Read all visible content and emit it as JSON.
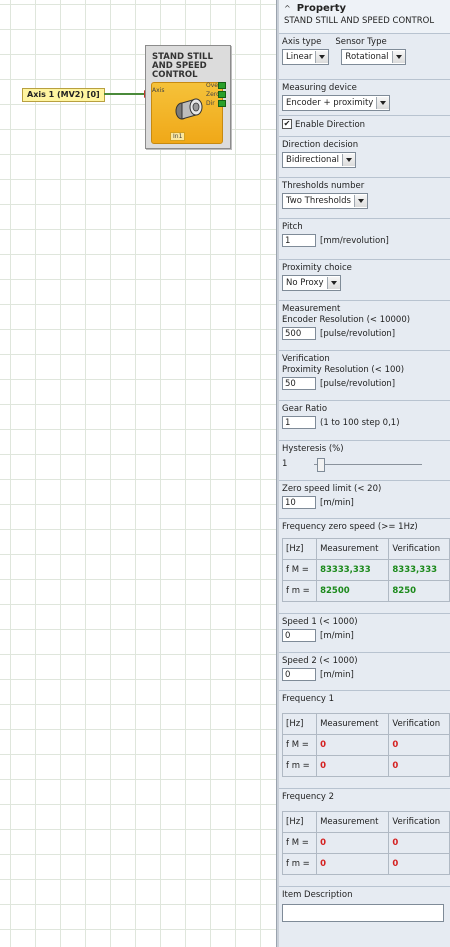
{
  "block": {
    "title_lines": [
      "STAND STILL",
      "AND SPEED",
      "CONTROL"
    ],
    "input_port": "Axis",
    "outputs": [
      "Over",
      "Zero",
      "Dir"
    ],
    "input_tag": "In1"
  },
  "axis_label": "Axis 1 (MV2) [0]",
  "panel": {
    "caret": "^",
    "header_title": "Property",
    "header_subtitle": "STAND STILL AND SPEED CONTROL",
    "axis_type": {
      "label": "Axis type",
      "value": "Linear"
    },
    "sensor_type": {
      "label": "Sensor Type",
      "value": "Rotational"
    },
    "measuring_device": {
      "label": "Measuring device",
      "value": "Encoder + proximity"
    },
    "enable_direction": {
      "label": "Enable Direction",
      "checked": true,
      "mark": "✔"
    },
    "direction_decision": {
      "label": "Direction decision",
      "value": "Bidirectional"
    },
    "thresholds_number": {
      "label": "Thresholds number",
      "value": "Two Thresholds"
    },
    "pitch": {
      "label": "Pitch",
      "value": "1",
      "unit": "[mm/revolution]"
    },
    "proximity_choice": {
      "label": "Proximity choice",
      "value": "No Proxy"
    },
    "measurement": {
      "label": "Measurement",
      "sublabel": "Encoder Resolution  (< 10000)",
      "value": "500",
      "unit": "[pulse/revolution]"
    },
    "verification": {
      "label": "Verification",
      "sublabel": "Proximity Resolution  (< 100)",
      "value": "50",
      "unit": "[pulse/revolution]"
    },
    "gear_ratio": {
      "label": "Gear Ratio",
      "value": "1",
      "unit": "(1 to 100 step 0,1)"
    },
    "hysteresis": {
      "label": "Hysteresis (%)",
      "value": "1",
      "level": 0.05
    },
    "zero_speed": {
      "label": "Zero speed limit  (< 20)",
      "value": "10",
      "unit": "[m/min]"
    },
    "freq_zero": {
      "label": "Frequency zero speed (>= 1Hz)",
      "headers": [
        "[Hz]",
        "Measurement",
        "Verification"
      ],
      "rows": [
        {
          "name": "f M =",
          "measurement": "83333,333",
          "verification": "8333,333"
        },
        {
          "name": "f m =",
          "measurement": "82500",
          "verification": "8250"
        }
      ]
    },
    "speed1": {
      "label": "Speed 1  (< 1000)",
      "value": "0",
      "unit": "[m/min]"
    },
    "speed2": {
      "label": "Speed 2  (< 1000)",
      "value": "0",
      "unit": "[m/min]"
    },
    "freq1": {
      "label": "Frequency 1",
      "headers": [
        "[Hz]",
        "Measurement",
        "Verification"
      ],
      "rows": [
        {
          "name": "f M =",
          "measurement": "0",
          "verification": "0"
        },
        {
          "name": "f m =",
          "measurement": "0",
          "verification": "0"
        }
      ]
    },
    "freq2": {
      "label": "Frequency 2",
      "headers": [
        "[Hz]",
        "Measurement",
        "Verification"
      ],
      "rows": [
        {
          "name": "f M =",
          "measurement": "0",
          "verification": "0"
        },
        {
          "name": "f m =",
          "measurement": "0",
          "verification": "0"
        }
      ]
    },
    "item_description": {
      "label": "Item Description",
      "value": ""
    }
  },
  "colors": {
    "value_green": "#1c8a1c",
    "value_red": "#d42020",
    "block_yellow": "#f0a818",
    "pin_green": "#2aa02a"
  }
}
